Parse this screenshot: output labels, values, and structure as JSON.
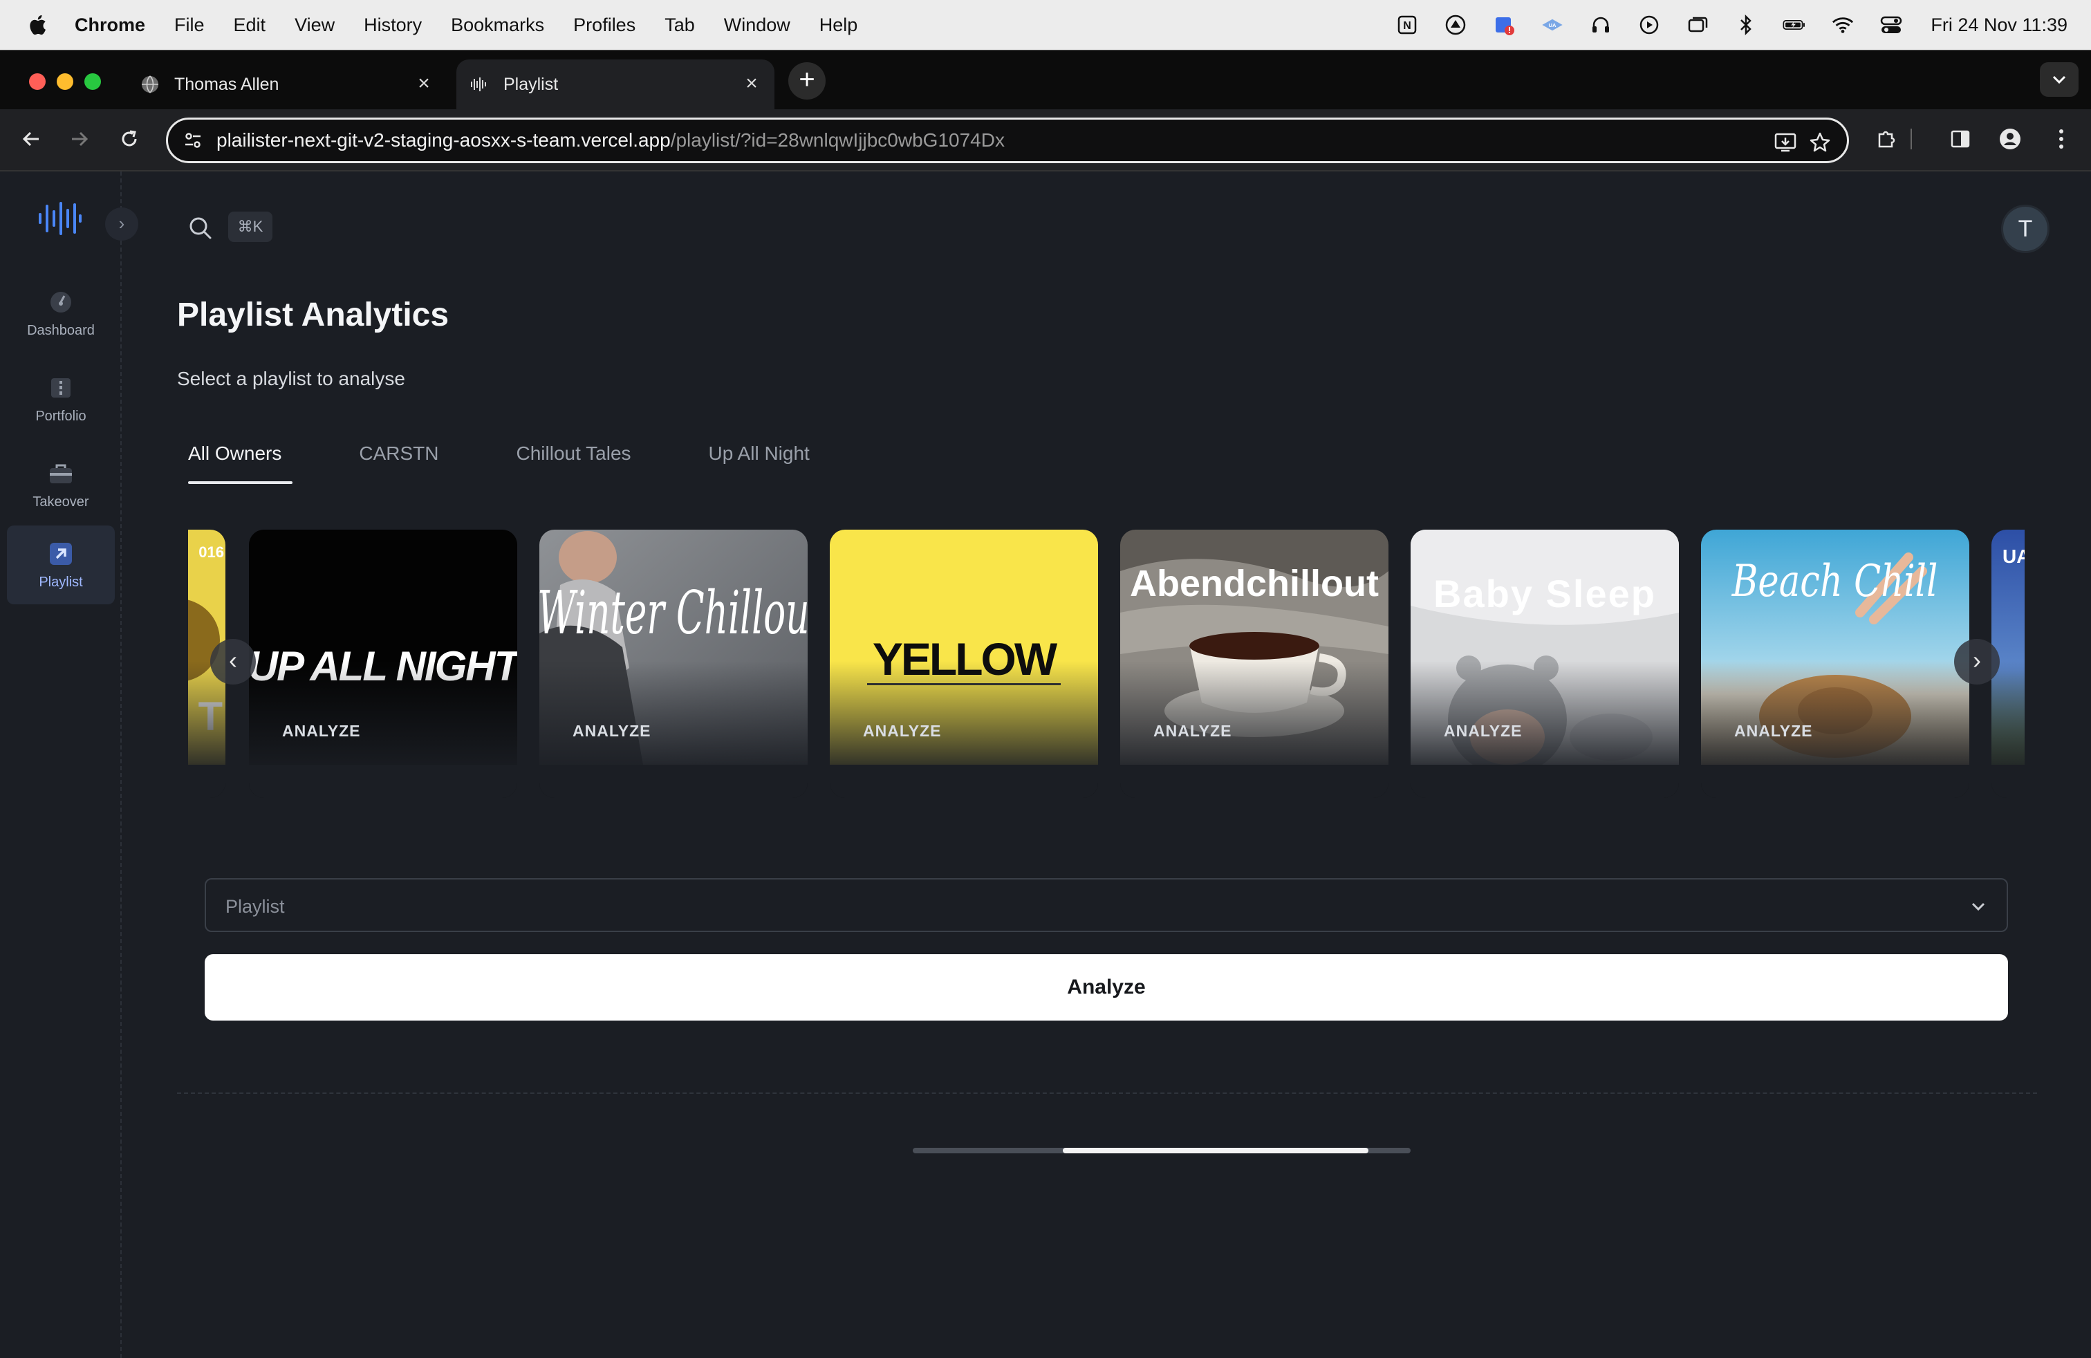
{
  "menubar": {
    "app_name": "Chrome",
    "items": [
      "File",
      "Edit",
      "View",
      "History",
      "Bookmarks",
      "Profiles",
      "Tab",
      "Window",
      "Help"
    ],
    "clock": "Fri 24 Nov  11:39",
    "status_icons": [
      "notion-icon",
      "sync-icon",
      "calendar-alert-icon",
      "vpn-icon",
      "headphones-icon",
      "play-icon",
      "window-icon",
      "bluetooth-icon",
      "battery-icon",
      "wifi-icon",
      "control-center-icon"
    ]
  },
  "browser": {
    "tabs": [
      {
        "title": "Thomas Allen",
        "icon": "globe-icon",
        "active": false
      },
      {
        "title": "Playlist",
        "icon": "waveform-icon",
        "active": true
      }
    ],
    "url_host": "plailister-next-git-v2-staging-aosxx-s-team.vercel.app",
    "url_path": "/playlist/?id=28wnlqwIjjbc0wbG1074Dx"
  },
  "sidebar": {
    "items": [
      {
        "label": "Dashboard",
        "icon": "gauge-icon",
        "active": false
      },
      {
        "label": "Portfolio",
        "icon": "folder-icon",
        "active": false
      },
      {
        "label": "Takeover",
        "icon": "briefcase-icon",
        "active": false
      },
      {
        "label": "Playlist",
        "icon": "arrow-up-right-icon",
        "active": true
      }
    ]
  },
  "header": {
    "search_shortcut": "⌘K",
    "avatar_initial": "T"
  },
  "page": {
    "title": "Playlist Analytics",
    "subtitle": "Select a playlist to analyse"
  },
  "owner_tabs": [
    {
      "label": "All Owners",
      "active": true
    },
    {
      "label": "CARSTN",
      "active": false
    },
    {
      "label": "Chillout Tales",
      "active": false
    },
    {
      "label": "Up All Night",
      "active": false
    }
  ],
  "playlists": [
    {
      "cover_text": "UP ALL NIGHT",
      "action": "ANALYZE"
    },
    {
      "cover_text": "Winter Chillout",
      "action": "ANALYZE"
    },
    {
      "cover_text": "YELLOW",
      "action": "ANALYZE"
    },
    {
      "cover_text": "Abendchillout",
      "action": "ANALYZE"
    },
    {
      "cover_text": "Baby Sleep",
      "action": "ANALYZE"
    },
    {
      "cover_text": "Beach Chill",
      "action": "ANALYZE"
    }
  ],
  "partial_cards": {
    "left_text_top": "016",
    "left_text_bottom": "T",
    "right_text": "UA"
  },
  "form": {
    "select_placeholder": "Playlist",
    "analyze_label": "Analyze"
  },
  "colors": {
    "background": "#1b1e24",
    "accent": "#4a86f7",
    "yellow_cover": "#f9e54a"
  }
}
